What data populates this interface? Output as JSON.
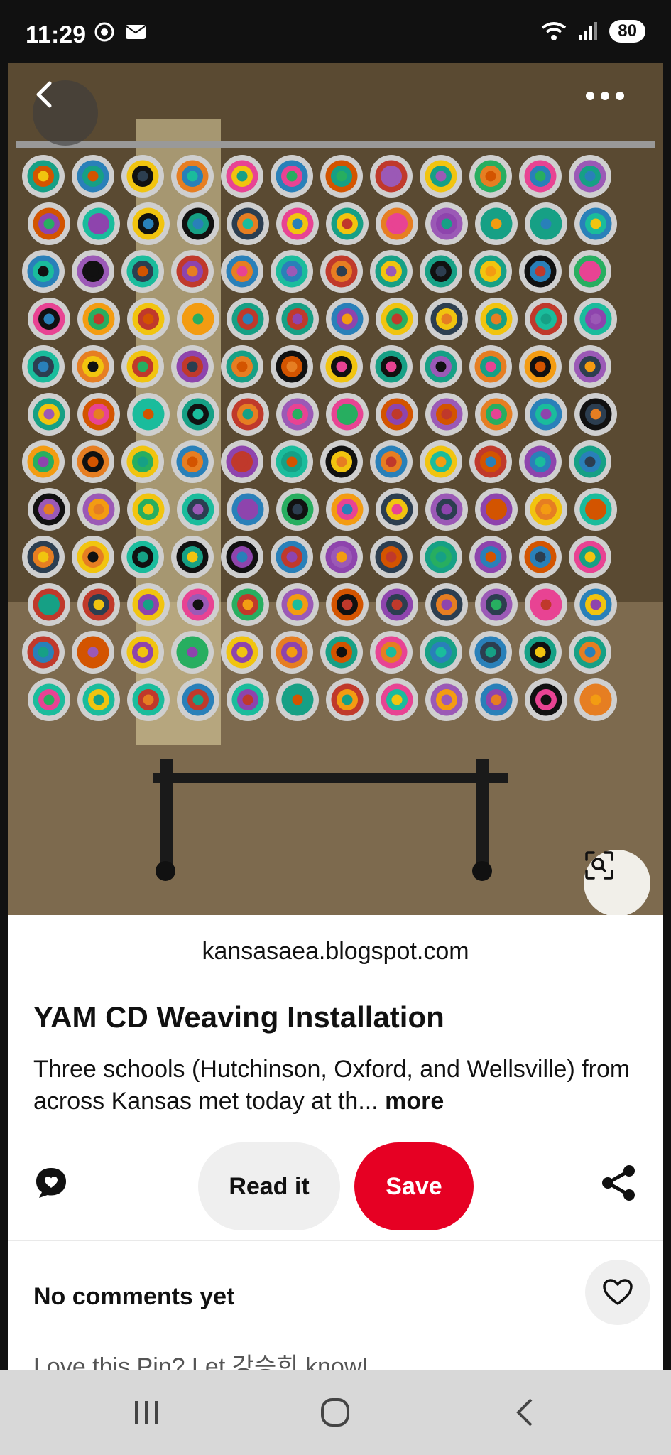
{
  "status_bar": {
    "time": "11:29",
    "battery": "80"
  },
  "pin": {
    "source": "kansasaea.blogspot.com",
    "title": "YAM CD Weaving Installation",
    "description": "Three schools (Hutchinson, Oxford, and Wellsville) from across Kansas met today at th...",
    "more_label": "more"
  },
  "actions": {
    "read_label": "Read it",
    "save_label": "Save"
  },
  "comments": {
    "title": "No comments yet",
    "prompt": "Love this Pin? Let 강승희 know!"
  },
  "colors": {
    "save": "#e60023",
    "read_bg": "#efefef"
  },
  "icons": {
    "back": "back-arrow-icon",
    "more": "more-dots-icon",
    "lens": "visual-search-icon",
    "comment": "comment-icon",
    "share": "share-icon",
    "heart": "heart-icon"
  }
}
